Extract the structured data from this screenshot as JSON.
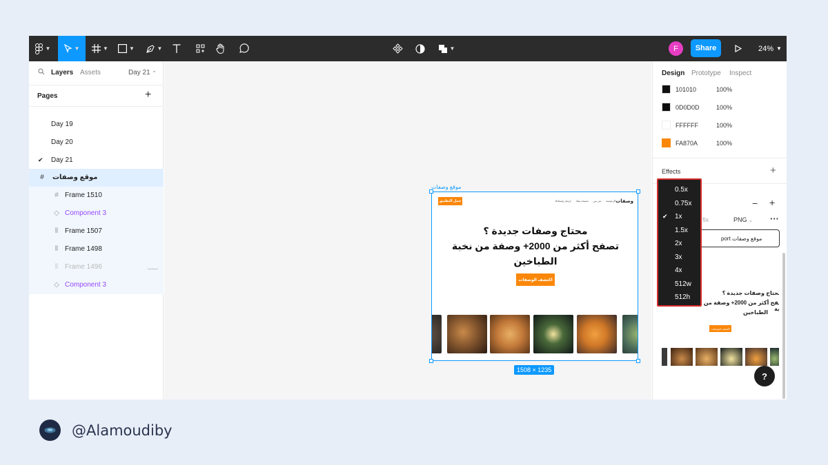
{
  "toolbar": {
    "avatar_initial": "F",
    "share_label": "Share",
    "zoom_label": "24%"
  },
  "left_panel": {
    "tabs": {
      "layers": "Layers",
      "assets": "Assets",
      "current_page": "Day 21"
    },
    "pages_heading": "Pages",
    "pages": [
      {
        "label": "Day 19",
        "checked": false
      },
      {
        "label": "Day 20",
        "checked": false
      },
      {
        "label": "Day 21",
        "checked": true
      }
    ],
    "layers": [
      {
        "label": "موقع وصفات",
        "icon": "frame-hash-icon",
        "selected": true
      },
      {
        "label": "Frame 1510",
        "icon": "frame-hash-icon"
      },
      {
        "label": "Component 3",
        "icon": "component-diamond-icon"
      },
      {
        "label": "Frame 1507",
        "icon": "auto-layout-icon"
      },
      {
        "label": "Frame 1498",
        "icon": "auto-layout-icon"
      },
      {
        "label": "Frame 1496",
        "icon": "auto-layout-icon",
        "hidden": true
      },
      {
        "label": "Component 3",
        "icon": "component-diamond-icon"
      }
    ]
  },
  "canvas": {
    "frame_name": "موقع وصفات",
    "size_badge": "1508 × 1235",
    "site": {
      "logo": "وصفات",
      "cta_top": "حمل التطبيق",
      "nav_links": [
        "الرئيسية",
        "عن بين",
        "نصيحة بيتك",
        "إرسل وصفاتك"
      ],
      "headline_line1": "محتاج وصفات جديدة ؟",
      "headline_line2": "تصفح أكثر من 2000+ وصفة من نخبة",
      "headline_line3": "الطباخين",
      "cta_main": "اكتشف الوصفات"
    }
  },
  "right_panel": {
    "tabs": {
      "design": "Design",
      "prototype": "Prototype",
      "inspect": "Inspect"
    },
    "colors": [
      {
        "hex": "101010",
        "opacity": "100%",
        "swatch": "#101010"
      },
      {
        "hex": "0D0D0D",
        "opacity": "100%",
        "swatch": "#0D0D0D"
      },
      {
        "hex": "FFFFFF",
        "opacity": "100%",
        "swatch": "#FFFFFF"
      },
      {
        "hex": "FA870A",
        "opacity": "100%",
        "swatch": "#FA870A"
      }
    ],
    "effects_label": "Effects",
    "export": {
      "suffix_fragment": "fix",
      "format": "PNG",
      "button_fragment": "port موقع وصفات"
    },
    "help_label": "?"
  },
  "scale_dropdown": {
    "options": [
      "0.5x",
      "0.75x",
      "1x",
      "1.5x",
      "2x",
      "3x",
      "4x",
      "512w",
      "512h"
    ],
    "selected": "1x"
  },
  "footer": {
    "handle": "@Alamoudiby"
  },
  "colors": {
    "accent": "#0d99ff",
    "brand_orange": "#FA870A",
    "toolbar_bg": "#2c2c2c",
    "highlight_border": "#d62b2b"
  }
}
